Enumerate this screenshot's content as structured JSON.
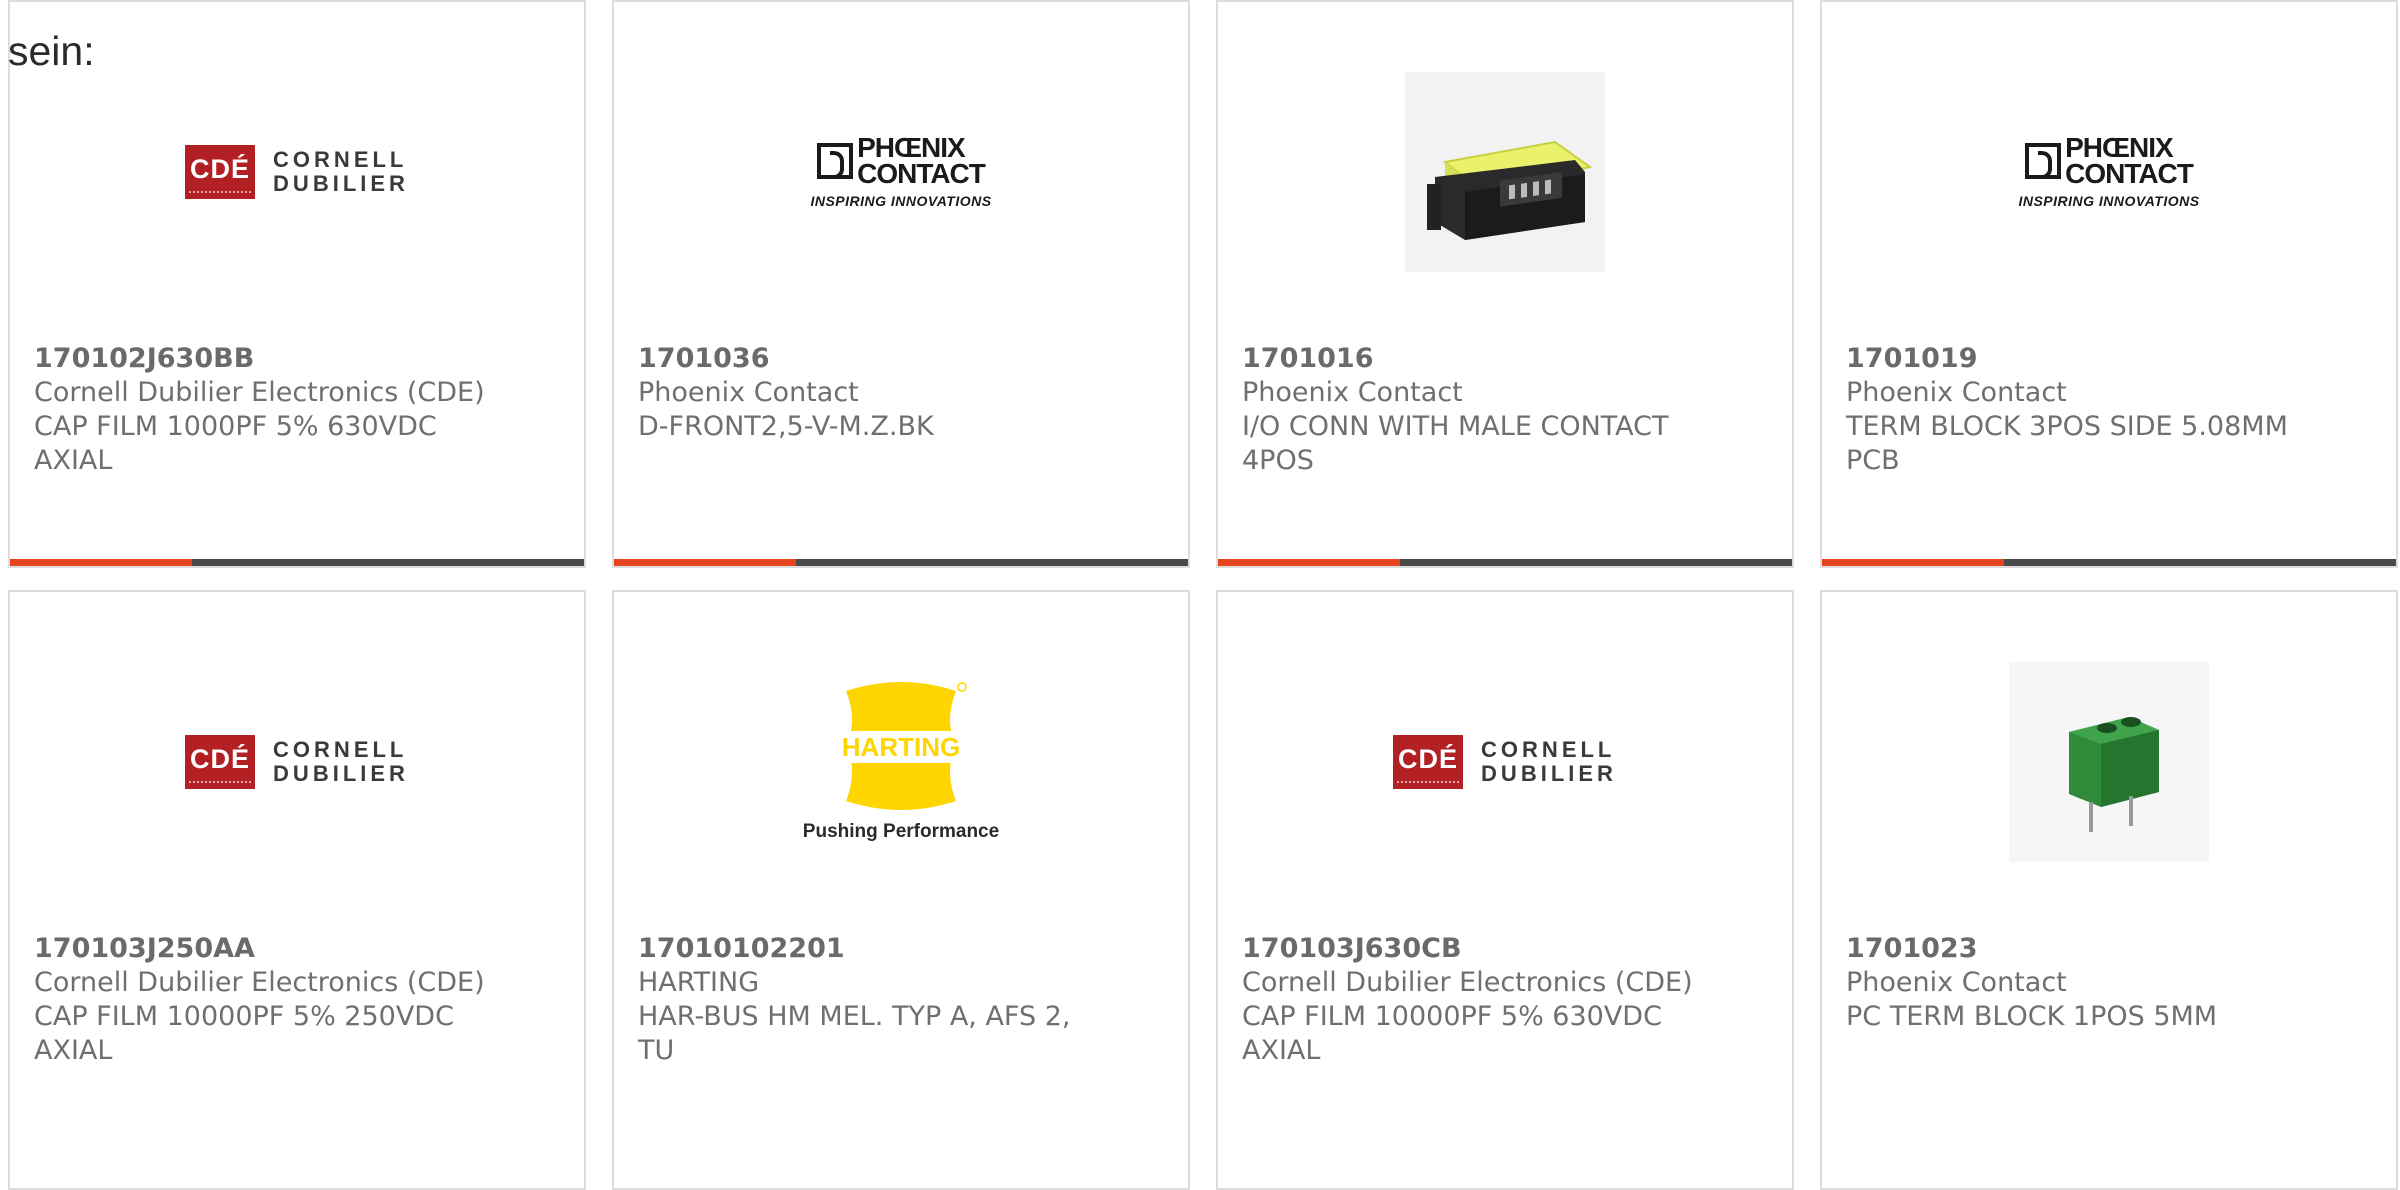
{
  "intro_text": "sein:",
  "colors": {
    "accent": "#e8431f",
    "bar": "#4a4a4a",
    "cde_red": "#b32024",
    "harting_yellow": "#ffd500",
    "terminal_green": "#2f8a3a"
  },
  "products": [
    {
      "part_number": "170102J630BB",
      "manufacturer": "Cornell Dubilier Electronics (CDE)",
      "description": "CAP FILM 1000PF 5% 630VDC AXIAL",
      "image": "cde-logo"
    },
    {
      "part_number": "1701036",
      "manufacturer": "Phoenix Contact",
      "description": "D-FRONT2,5-V-M.Z.BK",
      "image": "phoenix-contact-logo"
    },
    {
      "part_number": "1701016",
      "manufacturer": "Phoenix Contact",
      "description": "I/O CONN WITH MALE CONTACT 4POS",
      "image": "connector-photo"
    },
    {
      "part_number": "1701019",
      "manufacturer": "Phoenix Contact",
      "description": "TERM BLOCK 3POS SIDE 5.08MM PCB",
      "image": "phoenix-contact-logo"
    },
    {
      "part_number": "170103J250AA",
      "manufacturer": "Cornell Dubilier Electronics (CDE)",
      "description": "CAP FILM 10000PF 5% 250VDC AXIAL",
      "image": "cde-logo"
    },
    {
      "part_number": "17010102201",
      "manufacturer": "HARTING",
      "description": "HAR-BUS HM MEL. TYP A, AFS 2, TU",
      "image": "harting-logo"
    },
    {
      "part_number": "170103J630CB",
      "manufacturer": "Cornell Dubilier Electronics (CDE)",
      "description": "CAP FILM 10000PF 5% 630VDC AXIAL",
      "image": "cde-logo"
    },
    {
      "part_number": "1701023",
      "manufacturer": "Phoenix Contact",
      "description": "PC TERM BLOCK 1POS 5MM",
      "image": "terminal-block-photo"
    }
  ],
  "logos": {
    "cde": {
      "mark": "CDÉ",
      "line1": "CORNELL",
      "line2": "DUBILIER"
    },
    "phoenix": {
      "line1": "PHŒNIX",
      "line2": "CONTACT",
      "tagline": "INSPIRING INNOVATIONS"
    },
    "harting": {
      "name": "HARTING",
      "tagline": "Pushing Performance"
    }
  }
}
